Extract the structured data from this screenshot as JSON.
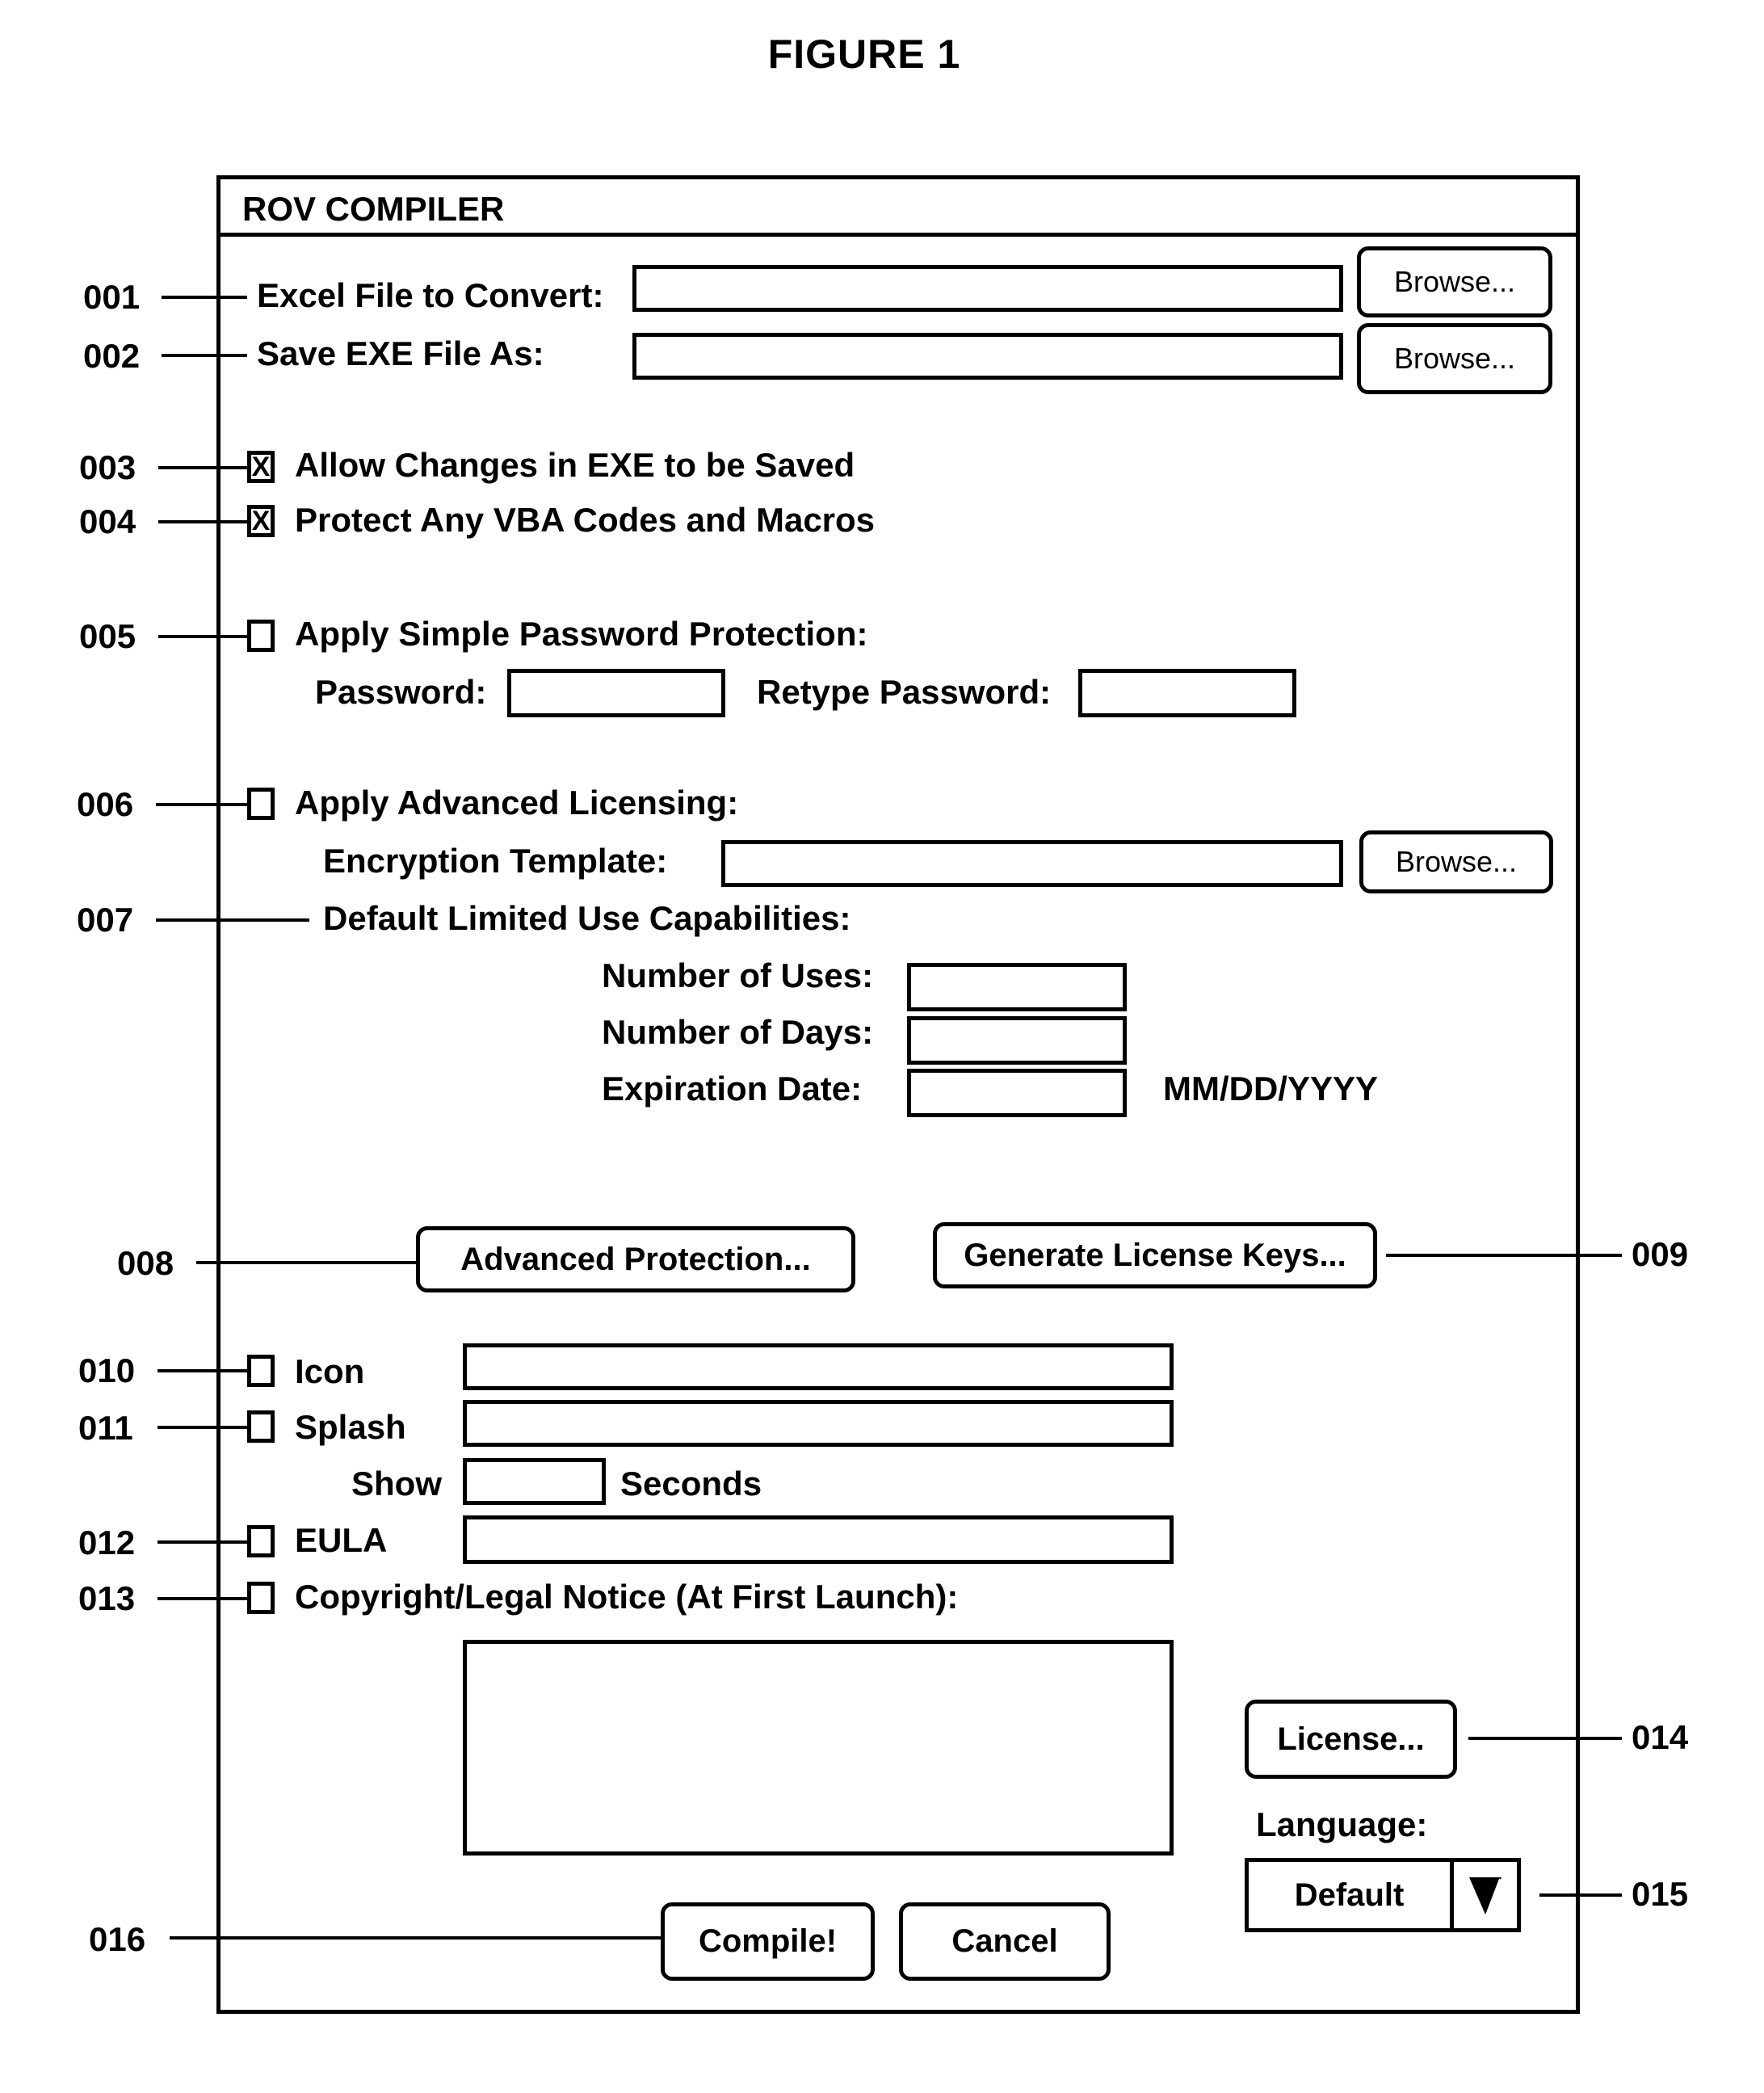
{
  "figure_title": "FIGURE 1",
  "window": {
    "title": "ROV COMPILER"
  },
  "callouts": {
    "c001": "001",
    "c002": "002",
    "c003": "003",
    "c004": "004",
    "c005": "005",
    "c006": "006",
    "c007": "007",
    "c008": "008",
    "c009": "009",
    "c010": "010",
    "c011": "011",
    "c012": "012",
    "c013": "013",
    "c014": "014",
    "c015": "015",
    "c016": "016"
  },
  "files": {
    "excel_label": "Excel File to Convert:",
    "excel_value": "",
    "save_label": "Save EXE File As:",
    "save_value": "",
    "browse_label": "Browse..."
  },
  "options": {
    "allow_changes": {
      "label": "Allow Changes in EXE to be Saved",
      "checked": true,
      "mark": "X"
    },
    "protect_vba": {
      "label": "Protect Any VBA Codes and Macros",
      "checked": true,
      "mark": "X"
    }
  },
  "password": {
    "checkbox_label": "Apply Simple Password Protection:",
    "checked": false,
    "password_label": "Password:",
    "password_value": "",
    "retype_label": "Retype Password:",
    "retype_value": ""
  },
  "licensing": {
    "checkbox_label": "Apply Advanced Licensing:",
    "checked": false,
    "template_label": "Encryption Template:",
    "template_value": "",
    "browse_label": "Browse...",
    "limited_use_label": "Default Limited Use Capabilities:",
    "uses_label": "Number of Uses:",
    "uses_value": "",
    "days_label": "Number of Days:",
    "days_value": "",
    "expiration_label": "Expiration Date:",
    "expiration_value": "",
    "date_format_hint": "MM/DD/YYYY"
  },
  "actions": {
    "advanced_protection": "Advanced Protection...",
    "generate_keys": "Generate License Keys..."
  },
  "branding": {
    "icon_label": "Icon",
    "icon_checked": false,
    "icon_value": "",
    "splash_label": "Splash",
    "splash_checked": false,
    "splash_value": "",
    "show_label": "Show",
    "show_seconds_value": "",
    "seconds_label": "Seconds",
    "eula_label": "EULA",
    "eula_checked": false,
    "eula_value": "",
    "copyright_label": "Copyright/Legal Notice (At First Launch):",
    "copyright_checked": false,
    "copyright_value": ""
  },
  "license_button": "License...",
  "language": {
    "label": "Language:",
    "selected": "Default"
  },
  "footer": {
    "compile": "Compile!",
    "cancel": "Cancel"
  }
}
